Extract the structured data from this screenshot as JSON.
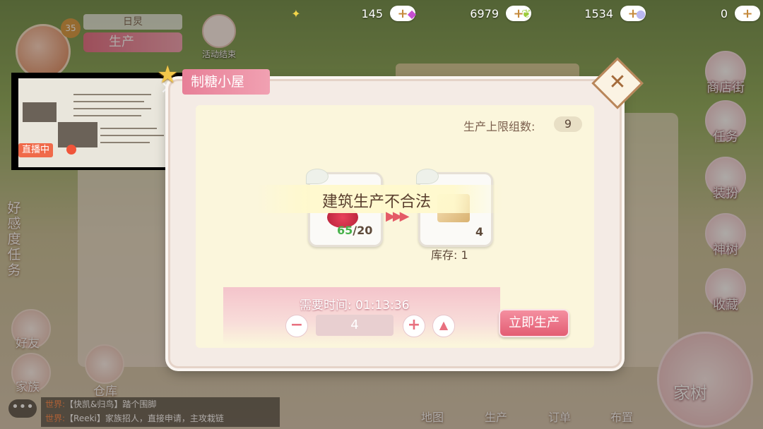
{
  "currencies": [
    {
      "icon": "star-sparkle-icon",
      "glyph": "✦",
      "value": "145",
      "color": "#f2d54a"
    },
    {
      "icon": "candy-icon",
      "glyph": "◆",
      "value": "6979",
      "color": "#c54fd0"
    },
    {
      "icon": "leaf-icon",
      "glyph": "❦",
      "value": "1534",
      "color": "#9ccc3a"
    },
    {
      "icon": "pearl-icon",
      "glyph": "●",
      "value": "0",
      "color": "#b9b7f0"
    }
  ],
  "plus_label": "+",
  "player": {
    "level": "35",
    "name": "日炅",
    "production_label": "生产"
  },
  "event": {
    "label": "活动结束"
  },
  "stream": {
    "live_label": "直播中",
    "close": "×"
  },
  "left_menu": {
    "affection": "好感度任务",
    "friends": "好友",
    "family": "家族",
    "warehouse": "仓库",
    "upgrade": "升级",
    "idle": "空闲中"
  },
  "right_menu": [
    {
      "label": "商店街",
      "icon": "shop-icon"
    },
    {
      "label": "任务",
      "icon": "task-icon"
    },
    {
      "label": "装扮",
      "icon": "dressup-icon"
    },
    {
      "label": "神树",
      "icon": "sacred-tree-icon"
    },
    {
      "label": "收藏",
      "icon": "collection-icon"
    }
  ],
  "bottom_nav": [
    "地图",
    "生产",
    "订单",
    "布置"
  ],
  "family_tree_label": "家树",
  "chat": [
    {
      "tag": "世界:",
      "text": "【快凯&归鸟】踏个围脚"
    },
    {
      "tag": "世界:",
      "text": "【Reeki】家族招人，直接申请，主攻栽链"
    }
  ],
  "chat_button": "•••",
  "modal": {
    "title": "制糖小屋",
    "limit_label": "生产上限组数:",
    "limit_value": "9",
    "input_count": "65",
    "input_required": "/20",
    "output_count": "4",
    "error_text": "建筑生产不合法",
    "stock_label": "库存: 1",
    "time_label": "需要时间: 01:13:36",
    "quantity": "4",
    "minus": "−",
    "plus": "+",
    "max": "▲",
    "produce_button": "立即生产",
    "close": "✕"
  }
}
